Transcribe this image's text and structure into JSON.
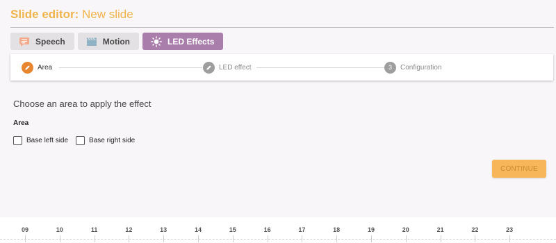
{
  "header": {
    "title_label": "Slide editor:",
    "slide_name": "New slide"
  },
  "tabs": [
    {
      "label": "Speech",
      "icon": "speech-bubble-icon",
      "active": false
    },
    {
      "label": "Motion",
      "icon": "clapperboard-icon",
      "active": false
    },
    {
      "label": "LED Effects",
      "icon": "sun-icon",
      "active": true
    }
  ],
  "stepper": {
    "steps": [
      {
        "label": "Area",
        "icon": "pencil-icon",
        "state": "active"
      },
      {
        "label": "LED effect",
        "icon": "pencil-icon",
        "state": "pending"
      },
      {
        "label": "Configuration",
        "number": "3",
        "state": "pending"
      }
    ]
  },
  "area_step": {
    "instruction": "Choose an area to apply the effect",
    "section_label": "Area",
    "options": [
      {
        "label": "Base left side",
        "checked": false
      },
      {
        "label": "Base right side",
        "checked": false
      }
    ],
    "continue_label": "CONTINUE"
  },
  "timeline": {
    "ticks": [
      "09",
      "10",
      "11",
      "12",
      "13",
      "14",
      "15",
      "16",
      "17",
      "18",
      "19",
      "20",
      "21",
      "22",
      "23"
    ]
  },
  "colors": {
    "accent_orange": "#f0b44c",
    "active_tab": "#a97eab",
    "active_step": "#e8852f",
    "continue_button": "#f7b659"
  }
}
